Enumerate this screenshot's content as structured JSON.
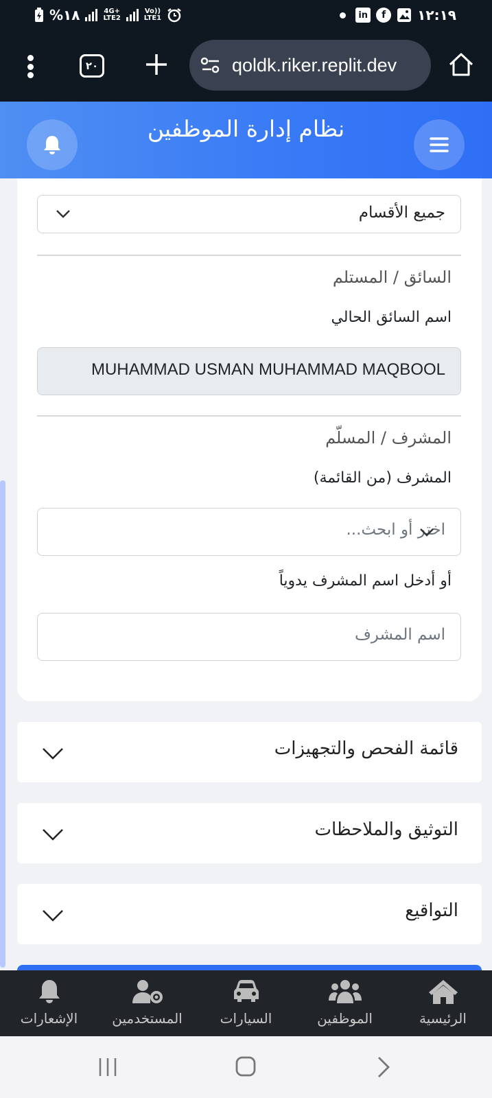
{
  "status_bar": {
    "battery": "%١٨",
    "network_1": "4G+",
    "network_1_sub": "LTE2",
    "network_2": "Vo))",
    "network_2_sub": "LTE1",
    "time": "١٢:١٩"
  },
  "browser": {
    "tab_count": "٢٠",
    "url": "qoldk.riker.replit.dev"
  },
  "header": {
    "title": "نظام إدارة الموظفين"
  },
  "form": {
    "department_select": {
      "value": "جميع الأقسام"
    },
    "driver_section_title": "السائق / المستلم",
    "current_driver_label": "اسم السائق الحالي",
    "current_driver_value": "MUHAMMAD USMAN MUHAMMAD MAQBOOL",
    "supervisor_section_title": "المشرف / المسلّم",
    "supervisor_list_label": "المشرف (من القائمة)",
    "supervisor_select_placeholder": "اختر أو ابحث...",
    "supervisor_manual_label": "أو أدخل اسم المشرف يدوياً",
    "supervisor_name_placeholder": "اسم المشرف"
  },
  "accordions": [
    {
      "label": "قائمة الفحص والتجهيزات"
    },
    {
      "label": "التوثيق والملاحظات"
    },
    {
      "label": "التواقيع"
    }
  ],
  "bottom_nav": {
    "home": "الرئيسية",
    "employees": "الموظفين",
    "cars": "السيارات",
    "users": "المستخدمين",
    "notifications": "الإشعارات"
  },
  "colors": {
    "header_blue": "#3879f6",
    "nav_dark": "#212428",
    "browser_dark": "#0f1821"
  }
}
